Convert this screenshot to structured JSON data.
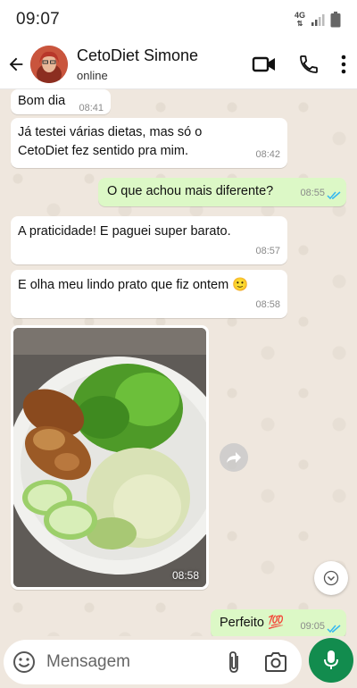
{
  "status_bar": {
    "time": "09:07",
    "network": "4G"
  },
  "header": {
    "contact_name": "CetoDiet Simone",
    "contact_status": "online"
  },
  "messages": [
    {
      "direction": "in",
      "text": "Bom dia",
      "time": "08:41"
    },
    {
      "direction": "in",
      "text": "Já testei várias dietas, mas só o CetoDiet fez sentido pra mim.",
      "time": "08:42"
    },
    {
      "direction": "out",
      "text": "O que achou mais diferente?",
      "time": "08:55",
      "status": "read"
    },
    {
      "direction": "in",
      "text": "A praticidade! E paguei super barato.",
      "time": "08:57"
    },
    {
      "direction": "in",
      "text": "E olha meu lindo prato que fiz ontem 🙂",
      "time": "08:58"
    },
    {
      "direction": "in",
      "type": "image",
      "time": "08:58",
      "image_description": "plate with grilled chicken, lettuce, cabbage and cucumber"
    },
    {
      "direction": "out",
      "text": "Perfeito 💯",
      "time": "09:05",
      "status": "read"
    }
  ],
  "composer": {
    "placeholder": "Mensagem"
  },
  "colors": {
    "outgoing_bubble": "#dcf8c6",
    "incoming_bubble": "#ffffff",
    "read_ticks": "#34b7f1",
    "mic_button": "#128c4e",
    "chat_background": "#efe7de"
  },
  "icons": {
    "back": "arrow-left-icon",
    "video": "video-call-icon",
    "phone": "phone-icon",
    "menu": "more-vertical-icon",
    "emoji": "emoji-icon",
    "attach": "paperclip-icon",
    "camera": "camera-icon",
    "mic": "mic-icon",
    "forward": "forward-icon",
    "scroll": "chevron-down-icon"
  }
}
